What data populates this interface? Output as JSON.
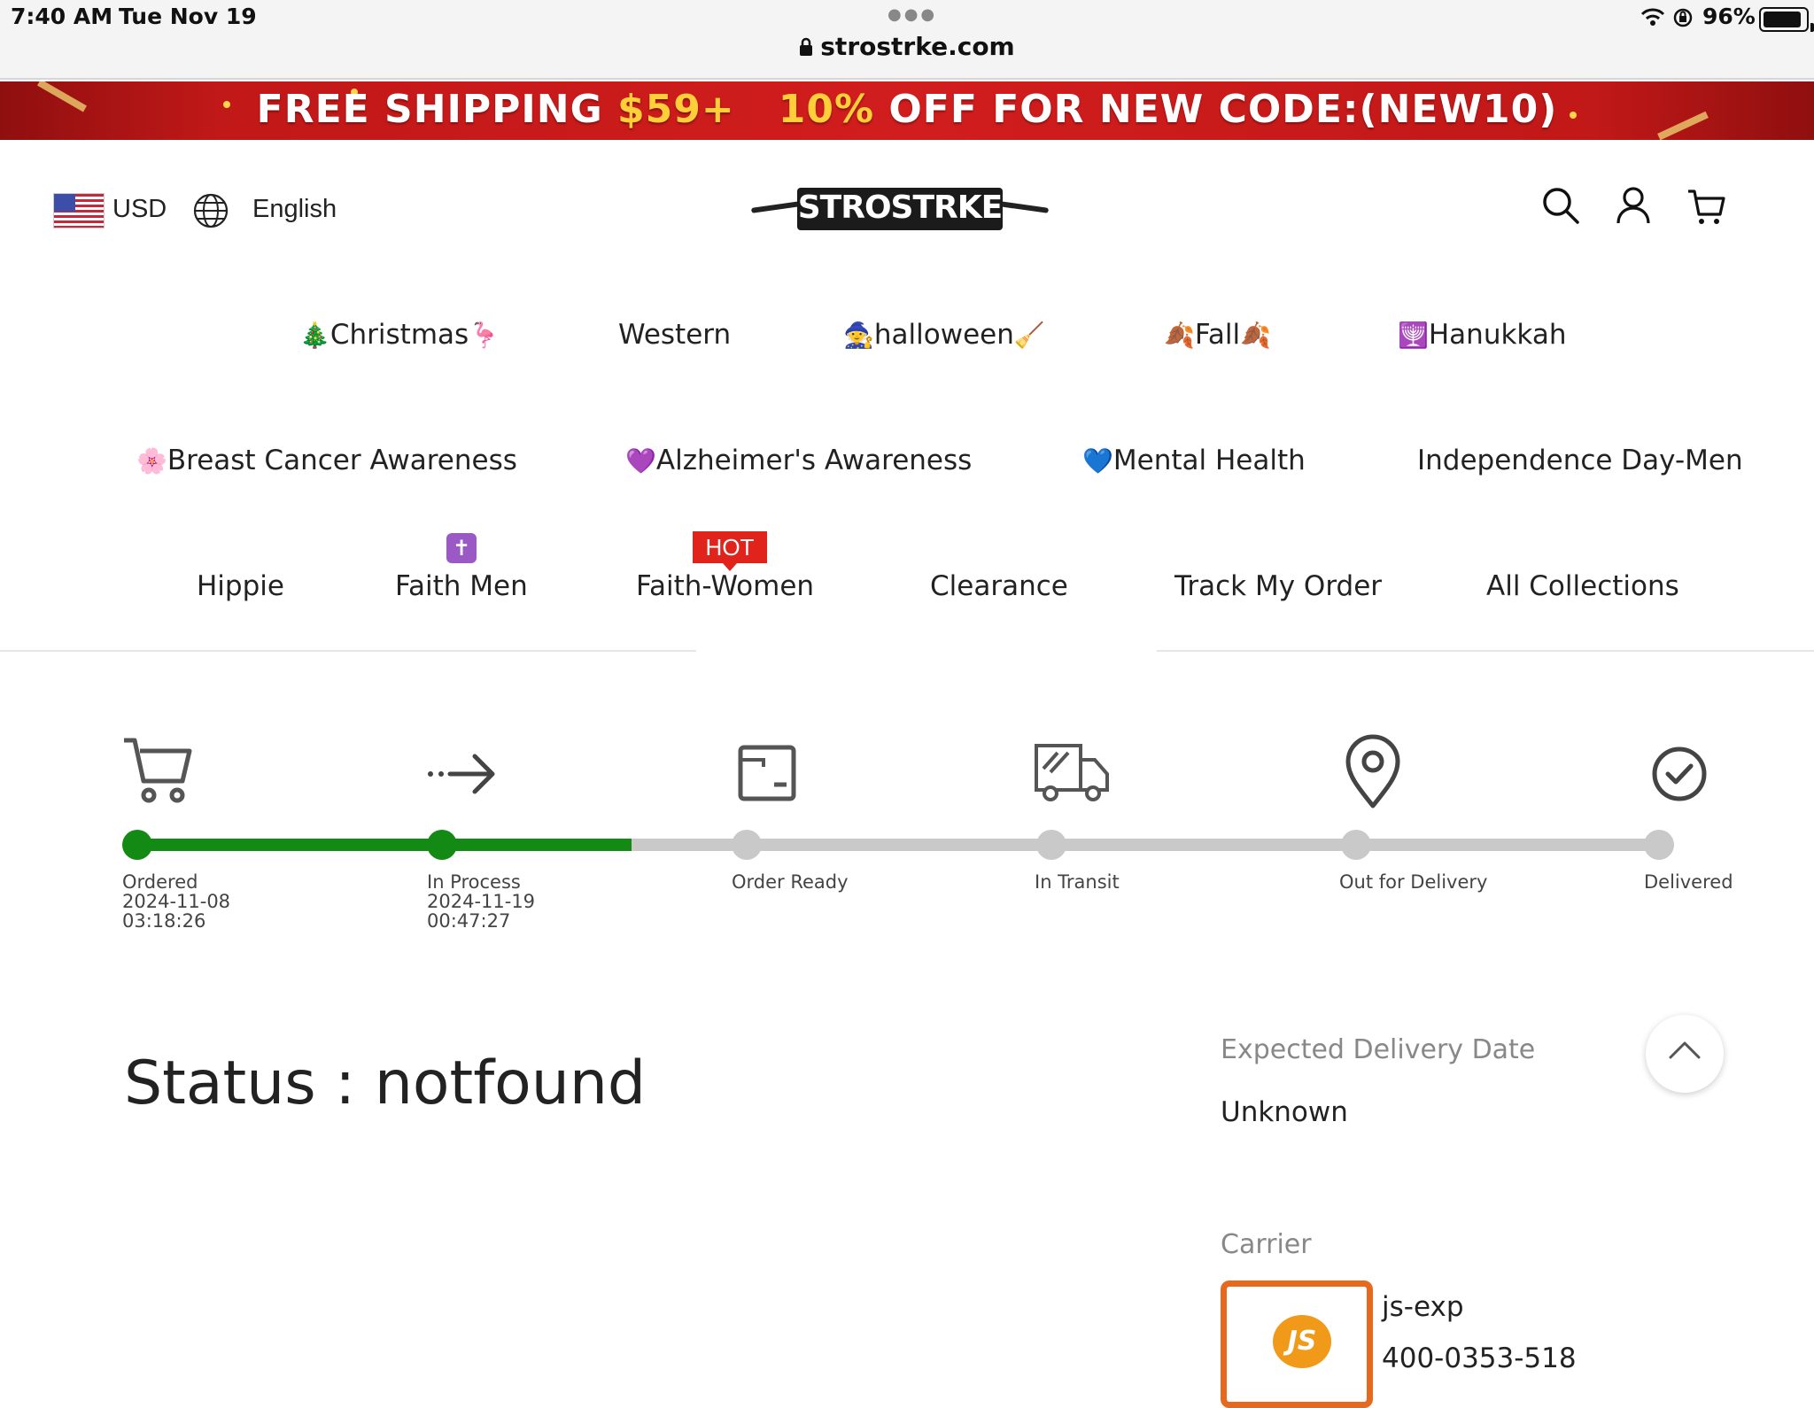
{
  "status_bar": {
    "time": "7:40 AM",
    "date": "Tue Nov 19",
    "url": "strostrke.com",
    "battery": "96%"
  },
  "banner": {
    "free_shipping": "FREE SHIPPING",
    "threshold": "$59+",
    "discount": "10%",
    "code_text": "OFF FOR NEW CODE:(NEW10)"
  },
  "header": {
    "currency": "USD",
    "language": "English",
    "logo_text": "STROSTRKE"
  },
  "nav": {
    "row1": [
      {
        "prefix": "🎄",
        "label": "Christmas",
        "suffix": "🦩"
      },
      {
        "prefix": "",
        "label": "Western",
        "suffix": ""
      },
      {
        "prefix": "🧙",
        "label": "halloween",
        "suffix": "🧹"
      },
      {
        "prefix": "🍂",
        "label": "Fall",
        "suffix": "🍂"
      },
      {
        "prefix": "🕎",
        "label": "Hanukkah",
        "suffix": ""
      }
    ],
    "row2": [
      {
        "prefix": "🌸",
        "label": "Breast Cancer Awareness"
      },
      {
        "prefix": "💜",
        "label": "Alzheimer's Awareness"
      },
      {
        "prefix": "💙",
        "label": "Mental Health"
      },
      {
        "prefix": "",
        "label": "Independence Day-Men"
      }
    ],
    "row3": [
      {
        "label": "Hippie"
      },
      {
        "label": "Faith Men",
        "badge": "✝️"
      },
      {
        "label": "Faith-Women",
        "badge": "HOT"
      },
      {
        "label": "Clearance"
      },
      {
        "label": "Track My Order"
      },
      {
        "label": "All Collections"
      }
    ]
  },
  "tracking": {
    "progress_fraction": 0.325,
    "steps": [
      {
        "label": "Ordered",
        "date": "2024-11-08",
        "time": "03:18:26",
        "done": true,
        "icon": "cart-icon"
      },
      {
        "label": "In Process",
        "date": "2024-11-19",
        "time": "00:47:27",
        "done": true,
        "icon": "arrow-right-icon"
      },
      {
        "label": "Order Ready",
        "date": "",
        "time": "",
        "done": false,
        "icon": "wallet-box-icon"
      },
      {
        "label": "In Transit",
        "date": "",
        "time": "",
        "done": false,
        "icon": "truck-icon"
      },
      {
        "label": "Out for Delivery",
        "date": "",
        "time": "",
        "done": false,
        "icon": "location-pin-icon"
      },
      {
        "label": "Delivered",
        "date": "",
        "time": "",
        "done": false,
        "icon": "check-circle-icon"
      }
    ]
  },
  "order": {
    "status": "Status : notfound",
    "expected_label": "Expected Delivery Date",
    "expected_value": "Unknown",
    "carrier_label": "Carrier",
    "carrier_name": "js-exp",
    "carrier_phone": "400-0353-518",
    "carrier_logo_text": "JS"
  },
  "colors": {
    "progress_done": "#138a13",
    "progress_todo": "#c9c9c9",
    "banner_red": "#d11d1d",
    "banner_gold": "#ffcf3a",
    "hot_badge": "#e0241b",
    "carrier_orange": "#e56a1f"
  }
}
